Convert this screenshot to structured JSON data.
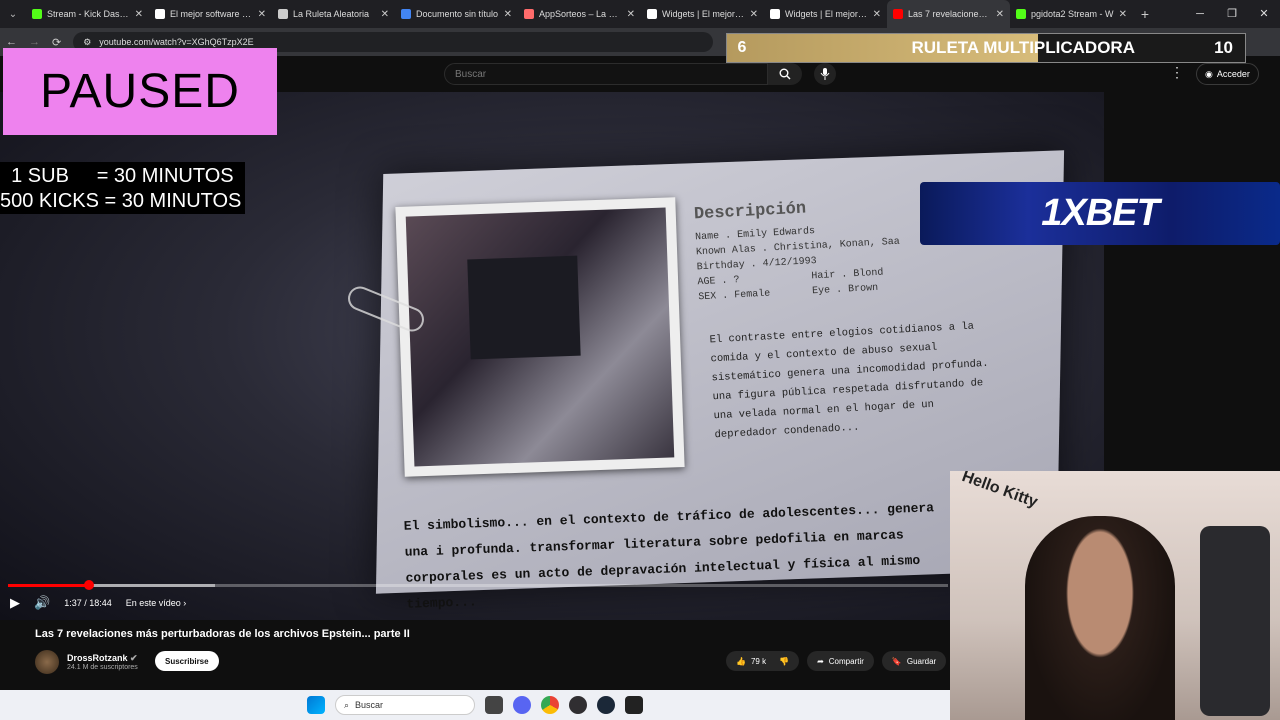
{
  "browser": {
    "tabs": [
      {
        "title": "Stream - Kick Dashbo",
        "favicon_color": "#53fc18"
      },
      {
        "title": "El mejor software par",
        "favicon_color": "#ffffff"
      },
      {
        "title": "La Ruleta Aleatoria",
        "favicon_color": "#cccccc"
      },
      {
        "title": "Documento sin título",
        "favicon_color": "#4285f4"
      },
      {
        "title": "AppSorteos – La Rule",
        "favicon_color": "#ff6b6b"
      },
      {
        "title": "Widgets | El mejor so",
        "favicon_color": "#ffffff"
      },
      {
        "title": "Widgets | El mejor so",
        "favicon_color": "#ffffff"
      },
      {
        "title": "Las 7 revelaciones m",
        "favicon_color": "#ff0000"
      },
      {
        "title": "pgidota2 Stream - W",
        "favicon_color": "#53fc18"
      }
    ],
    "url": "youtube.com/watch?v=XGhQ6TzpX2E"
  },
  "youtube": {
    "search_placeholder": "Buscar",
    "signin_label": "Acceder",
    "video": {
      "doc_heading": "Descripción",
      "doc_lines": [
        "Name . Emily Edwards",
        "Known Alas . Christina, Konan, Saa",
        "Birthday . 4/12/1993",
        "AGE . ?            Hair . Blond",
        "SEX . Female       Eye . Brown"
      ],
      "doc_paragraph": "El contraste entre elogios cotidianos a la comida y el contexto de abuso sexual sistemático genera una incomodidad profunda. una figura pública respetada disfrutando de una velada normal en el hogar de un depredador condenado...",
      "caption": "El simbolismo... en el contexto de tráfico de adolescentes... genera una i profunda. transformar literatura sobre pedofilia en marcas corporales es un acto de depravación intelectual y física al mismo tiempo...",
      "time_display": "1:37 / 18:44",
      "chapter_label": "En este vídeo",
      "progress_fraction": 0.086,
      "buffer_fraction": 0.22
    },
    "title": "Las 7 revelaciones más perturbadoras de los archivos Epstein... parte II",
    "channel": {
      "name": "DrossRotzank",
      "subscribers": "24.1 M de suscriptores"
    },
    "subscribe_label": "Suscribirse",
    "likes": "79 k",
    "share_label": "Compartir",
    "save_label": "Guardar"
  },
  "overlay": {
    "paused": "PAUSED",
    "sub_rules": [
      "  1 SUB     = 30 MINUTOS",
      "500 KICKS = 30 MINUTOS"
    ],
    "roulette": {
      "left_number": "6",
      "label": "RULETA MULTIPLICADORA",
      "right_number": "10"
    },
    "ad_text": "1XBET",
    "webcam_sign": "Hello Kitty"
  },
  "taskbar": {
    "search_label": "Buscar"
  }
}
